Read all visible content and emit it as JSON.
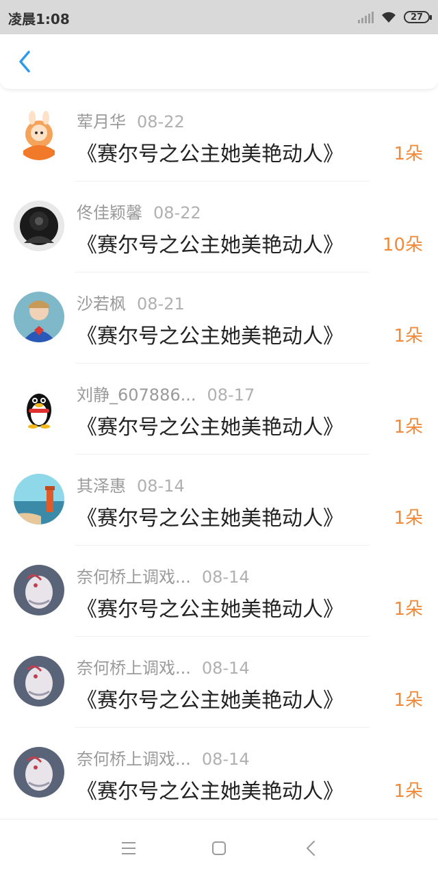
{
  "status_bar": {
    "time": "凌晨1:08",
    "battery": "27"
  },
  "header": {
    "back_icon": "chevron-left-icon"
  },
  "gifts": [
    {
      "name": "荤月华",
      "date": "08-22",
      "title": "《赛尔号之公主她美艳动人》",
      "count": "1朵"
    },
    {
      "name": "佟佳颖馨",
      "date": "08-22",
      "title": "《赛尔号之公主她美艳动人》",
      "count": "10朵"
    },
    {
      "name": "沙若枫",
      "date": "08-21",
      "title": "《赛尔号之公主她美艳动人》",
      "count": "1朵"
    },
    {
      "name": "刘静_607886...",
      "date": "08-17",
      "title": "《赛尔号之公主她美艳动人》",
      "count": "1朵"
    },
    {
      "name": "其泽惠",
      "date": "08-14",
      "title": "《赛尔号之公主她美艳动人》",
      "count": "1朵"
    },
    {
      "name": "奈何桥上调戏...",
      "date": "08-14",
      "title": "《赛尔号之公主她美艳动人》",
      "count": "1朵"
    },
    {
      "name": "奈何桥上调戏...",
      "date": "08-14",
      "title": "《赛尔号之公主她美艳动人》",
      "count": "1朵"
    },
    {
      "name": "奈何桥上调戏...",
      "date": "08-14",
      "title": "《赛尔号之公主她美艳动人》",
      "count": "1朵"
    }
  ],
  "colors": {
    "accent": "#f08a3a",
    "back": "#2e9bea"
  },
  "nav": {
    "icons": [
      "menu-icon",
      "home-icon",
      "back-icon"
    ]
  }
}
